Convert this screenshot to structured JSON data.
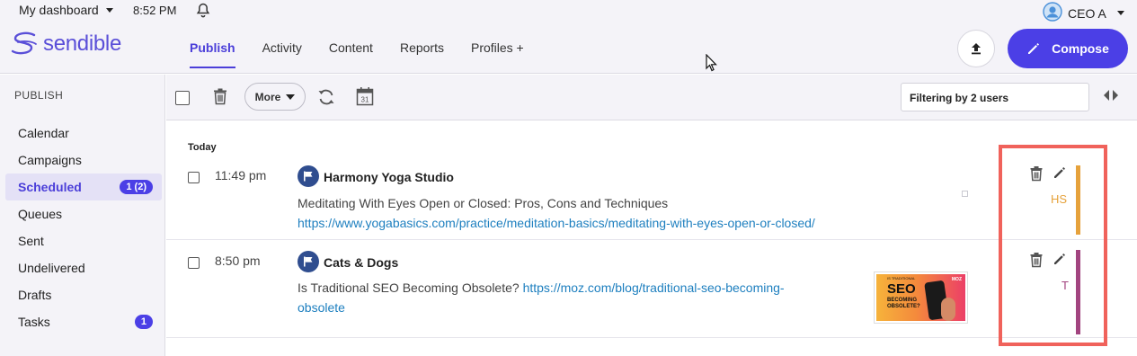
{
  "topbar": {
    "dashboard_label": "My dashboard",
    "time": "8:52 PM",
    "user_name": "CEO A"
  },
  "header": {
    "logo_text": "sendible",
    "nav": [
      {
        "label": "Publish",
        "active": true
      },
      {
        "label": "Activity",
        "active": false
      },
      {
        "label": "Content",
        "active": false
      },
      {
        "label": "Reports",
        "active": false
      },
      {
        "label": "Profiles +",
        "active": false
      }
    ],
    "compose_label": "Compose"
  },
  "sidebar": {
    "heading": "PUBLISH",
    "items": [
      {
        "label": "Calendar",
        "badge": ""
      },
      {
        "label": "Campaigns",
        "badge": ""
      },
      {
        "label": "Scheduled",
        "badge": "1 (2)",
        "active": true
      },
      {
        "label": "Queues",
        "badge": ""
      },
      {
        "label": "Sent",
        "badge": ""
      },
      {
        "label": "Undelivered",
        "badge": ""
      },
      {
        "label": "Drafts",
        "badge": ""
      },
      {
        "label": "Tasks",
        "badge": "1"
      }
    ]
  },
  "toolbar": {
    "more_label": "More",
    "calendar_day": "31",
    "filter_text": "Filtering by 2 users"
  },
  "content": {
    "day_label": "Today",
    "posts": [
      {
        "time": "11:49 pm",
        "profile": "Harmony Yoga Studio",
        "text": "Meditating With Eyes Open or Closed: Pros, Cons and Techniques",
        "link": "https://www.yogabasics.com/practice/meditation-basics/meditating-with-eyes-open-or-closed/",
        "initials": "HS",
        "user_color": "#e6a23c"
      },
      {
        "time": "8:50 pm",
        "profile": "Cats & Dogs",
        "text": "Is Traditional SEO Becoming Obsolete?",
        "link": "https://moz.com/blog/traditional-seo-becoming-obsolete",
        "link_line1": "https://moz.com/blog/traditional-seo-becoming-",
        "link_line2": "obsolete",
        "initials": "T",
        "user_color": "#a2447f",
        "thumbnail": {
          "top": "IS TRADITIONAL",
          "headline": "SEO",
          "sub": "BECOMING OBSOLETE?",
          "brand": "MOZ"
        }
      }
    ]
  },
  "colors": {
    "accent": "#4b3fe6",
    "highlight": "#f0625b",
    "link": "#1d7fbf"
  }
}
